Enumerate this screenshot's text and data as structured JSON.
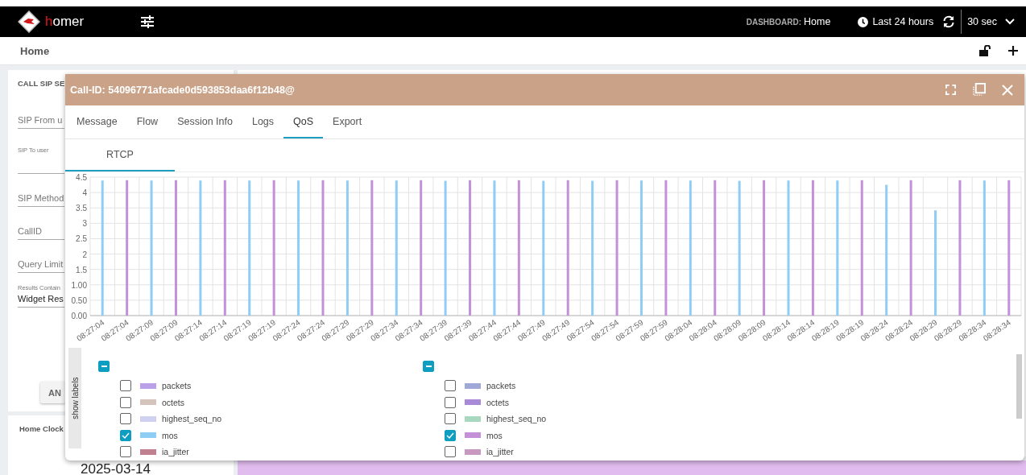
{
  "top_bar": {
    "brand_initial": "h",
    "brand_rest": "omer",
    "dashboard_label": "DASHBOARD:",
    "dashboard_name": "Home",
    "time_range": "Last 24 hours",
    "refresh_interval": "30 sec"
  },
  "page_title": "Home",
  "search_panel": {
    "title": "CALL SIP SE",
    "fields": [
      {
        "kind": "input",
        "placeholder": "SIP From u"
      },
      {
        "kind": "labeled",
        "label": "SIP To user"
      },
      {
        "kind": "input",
        "placeholder": "SIP Method"
      },
      {
        "kind": "input",
        "placeholder": "CallID"
      },
      {
        "kind": "input",
        "placeholder": "Query Limit"
      },
      {
        "kind": "select",
        "label": "Results Contain",
        "value": "Widget Res"
      }
    ],
    "button": "AN"
  },
  "clock_panel": {
    "title": "Home Clock",
    "date": "2025-03-14"
  },
  "modal": {
    "title": "Call-ID: 54096771afcade0d593853daa6f12b48@",
    "tabs": [
      {
        "label": "Message",
        "selected": false
      },
      {
        "label": "Flow",
        "selected": false
      },
      {
        "label": "Session Info",
        "selected": false
      },
      {
        "label": "Logs",
        "selected": false
      },
      {
        "label": "QoS",
        "selected": true
      },
      {
        "label": "Export",
        "selected": false
      }
    ],
    "subtabs": [
      {
        "label": "RTCP",
        "selected": true
      }
    ],
    "chart_data": {
      "type": "bar",
      "grid": true,
      "categories": [
        "08:27:04",
        "08:27:04",
        "08:27:09",
        "08:27:09",
        "08:27:14",
        "08:27:14",
        "08:27:19",
        "08:27:19",
        "08:27:24",
        "08:27:24",
        "08:27:29",
        "08:27:29",
        "08:27:34",
        "08:27:34",
        "08:27:39",
        "08:27:39",
        "08:27:44",
        "08:27:44",
        "08:27:49",
        "08:27:49",
        "08:27:54",
        "08:27:54",
        "08:27:59",
        "08:27:59",
        "08:28:04",
        "08:28:04",
        "08:28:09",
        "08:28:09",
        "08:28:14",
        "08:28:14",
        "08:28:19",
        "08:28:19",
        "08:28:24",
        "08:28:24",
        "08:28:29",
        "08:28:29",
        "08:28:34",
        "08:28:34"
      ],
      "series": [
        {
          "color": "#90cdf4",
          "values": [
            4.39,
            null,
            4.39,
            null,
            4.39,
            null,
            4.39,
            null,
            4.39,
            null,
            4.39,
            null,
            4.39,
            null,
            4.38,
            null,
            4.39,
            null,
            4.38,
            null,
            4.38,
            null,
            4.39,
            null,
            4.39,
            null,
            4.38,
            null,
            4.39,
            null,
            4.39,
            null,
            4.25,
            null,
            3.42,
            null,
            4.39,
            null
          ]
        },
        {
          "color": "#c490d8",
          "values": [
            null,
            4.4,
            null,
            4.4,
            null,
            4.4,
            null,
            4.4,
            null,
            4.4,
            null,
            4.4,
            null,
            4.4,
            null,
            4.4,
            null,
            4.4,
            null,
            4.4,
            null,
            4.4,
            null,
            4.4,
            null,
            4.4,
            null,
            4.4,
            null,
            4.4,
            null,
            4.4,
            null,
            4.4,
            null,
            4.4,
            null,
            4.4
          ]
        }
      ],
      "ylim": [
        0,
        4.5
      ],
      "yticks": [
        {
          "value": 0,
          "label": "0.00"
        },
        {
          "value": 0.5,
          "label": "0.50"
        },
        {
          "value": 1,
          "label": "1.00"
        },
        1.5,
        2,
        2.5,
        3,
        3.5,
        4,
        4.5
      ]
    },
    "show_labels": "show labels",
    "legend": [
      {
        "indeterminate": true,
        "items": [
          {
            "label": "packets",
            "color": "#b9a0e8",
            "checked": false
          },
          {
            "label": "octets",
            "color": "#d5c4bc",
            "checked": false
          },
          {
            "label": "highest_seq_no",
            "color": "#d0d0f0",
            "checked": false
          },
          {
            "label": "mos",
            "color": "#90cdf4",
            "checked": true
          },
          {
            "label": "ia_jitter",
            "color": "#c0808f",
            "checked": false
          }
        ]
      },
      {
        "indeterminate": true,
        "items": [
          {
            "label": "packets",
            "color": "#a0a8d8",
            "checked": false
          },
          {
            "label": "octets",
            "color": "#a88ad8",
            "checked": false
          },
          {
            "label": "highest_seq_no",
            "color": "#a8d8c0",
            "checked": false
          },
          {
            "label": "mos",
            "color": "#c490d8",
            "checked": true
          },
          {
            "label": "ia_jitter",
            "color": "#c898c0",
            "checked": false
          }
        ]
      }
    ]
  }
}
